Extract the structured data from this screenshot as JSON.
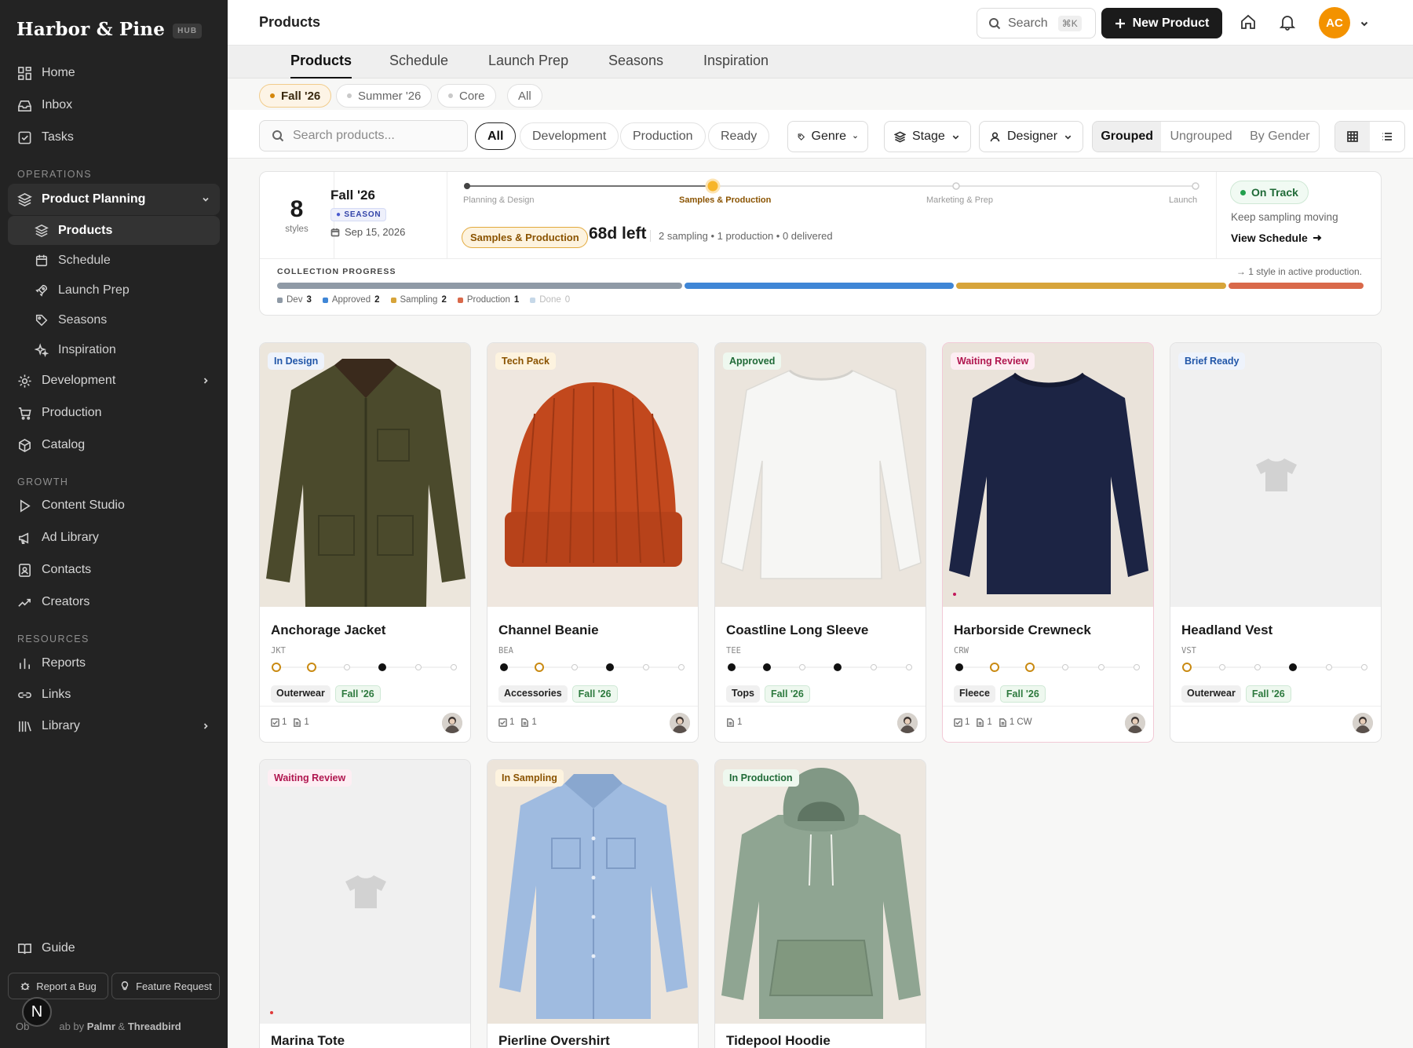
{
  "sidebar": {
    "brand": "Harbor & Pine",
    "brand_tag": "HUB",
    "top_items": [
      {
        "label": "Home",
        "icon": "home-grid-icon"
      },
      {
        "label": "Inbox",
        "icon": "inbox-icon"
      },
      {
        "label": "Tasks",
        "icon": "tasks-icon"
      }
    ],
    "section_operations": "OPERATIONS",
    "product_planning": "Product Planning",
    "sub_items": [
      {
        "label": "Products",
        "icon": "layers-icon"
      },
      {
        "label": "Schedule",
        "icon": "calendar-icon"
      },
      {
        "label": "Launch Prep",
        "icon": "rocket-icon"
      },
      {
        "label": "Seasons",
        "icon": "tag-icon"
      },
      {
        "label": "Inspiration",
        "icon": "sparkles-icon"
      }
    ],
    "ops_items": [
      {
        "label": "Development",
        "icon": "gear-icon"
      },
      {
        "label": "Production",
        "icon": "cart-icon"
      },
      {
        "label": "Catalog",
        "icon": "box-icon"
      }
    ],
    "section_growth": "GROWTH",
    "growth_items": [
      {
        "label": "Content Studio",
        "icon": "play-icon"
      },
      {
        "label": "Ad Library",
        "icon": "megaphone-icon"
      },
      {
        "label": "Contacts",
        "icon": "contact-icon"
      },
      {
        "label": "Creators",
        "icon": "trend-icon"
      }
    ],
    "section_resources": "RESOURCES",
    "resource_items": [
      {
        "label": "Reports",
        "icon": "bar-chart-icon"
      },
      {
        "label": "Links",
        "icon": "link-icon"
      },
      {
        "label": "Library",
        "icon": "library-icon"
      }
    ],
    "guide": "Guide",
    "report_bug": "Report a Bug",
    "feature_request": "Feature Request",
    "credit_prefix": "Ob",
    "credit_mid": "ab by",
    "credit_a": "Palmr",
    "credit_amp": "&",
    "credit_b": "Threadbird",
    "n_avatar": "N"
  },
  "topbar": {
    "title": "Products",
    "search_label": "Search",
    "search_kbd": "⌘K",
    "new_product": "New Product",
    "avatar_initials": "AC",
    "avatar_color": "#f39200"
  },
  "tabs": [
    "Products",
    "Schedule",
    "Launch Prep",
    "Seasons",
    "Inspiration"
  ],
  "season_chips": [
    "Fall '26",
    "Summer '26",
    "Core",
    "All"
  ],
  "filters": {
    "search_placeholder": "Search products...",
    "stage_pills": [
      "All",
      "Development",
      "Production",
      "Ready"
    ],
    "genre": "Genre",
    "stage": "Stage",
    "designer": "Designer",
    "grouping": [
      "Grouped",
      "Ungrouped",
      "By Gender"
    ]
  },
  "summary": {
    "count": "8",
    "count_label": "styles",
    "season": "Fall '26",
    "season_badge": "SEASON",
    "date": "Sep 15, 2026",
    "timeline_stages": [
      "Planning & Design",
      "Samples & Production",
      "Marketing & Prep",
      "Launch"
    ],
    "current_stage": "Samples & Production",
    "days_left": "68d left",
    "stage_counts": "2 sampling • 1 production • 0 delivered",
    "status": "On Track",
    "status_note": "Keep sampling moving",
    "view_schedule": "View Schedule",
    "progress_title": "COLLECTION PROGRESS",
    "progress_note": "→ 1 style in active production.",
    "legend": [
      {
        "label": "Dev",
        "count": "3",
        "color": "#8f9aa6"
      },
      {
        "label": "Approved",
        "count": "2",
        "color": "#3f86d6"
      },
      {
        "label": "Sampling",
        "count": "2",
        "color": "#d7a43a"
      },
      {
        "label": "Production",
        "count": "1",
        "color": "#d9694a"
      },
      {
        "label": "Done",
        "count": "0",
        "color": "#c6d8e8"
      }
    ]
  },
  "products": [
    {
      "name": "Anchorage Jacket",
      "code": "JKT",
      "status": "In Design",
      "category": "Outerwear",
      "season": "Fall '26",
      "tasks": "1",
      "docs": "1",
      "extra": ""
    },
    {
      "name": "Channel Beanie",
      "code": "BEA",
      "status": "Tech Pack",
      "category": "Accessories",
      "season": "Fall '26",
      "tasks": "1",
      "docs": "1",
      "extra": ""
    },
    {
      "name": "Coastline Long Sleeve",
      "code": "TEE",
      "status": "Approved",
      "category": "Tops",
      "season": "Fall '26",
      "tasks": "",
      "docs": "1",
      "extra": ""
    },
    {
      "name": "Harborside Crewneck",
      "code": "CRW",
      "status": "Waiting Review",
      "category": "Fleece",
      "season": "Fall '26",
      "tasks": "1",
      "docs": "1",
      "extra": "1 CW"
    },
    {
      "name": "Headland Vest",
      "code": "VST",
      "status": "Brief Ready",
      "category": "Outerwear",
      "season": "Fall '26",
      "tasks": "",
      "docs": "",
      "extra": ""
    },
    {
      "name": "Marina Tote",
      "status": "Waiting Review"
    },
    {
      "name": "Pierline Overshirt",
      "status": "In Sampling"
    },
    {
      "name": "Tidepool Hoodie",
      "status": "In Production"
    }
  ]
}
